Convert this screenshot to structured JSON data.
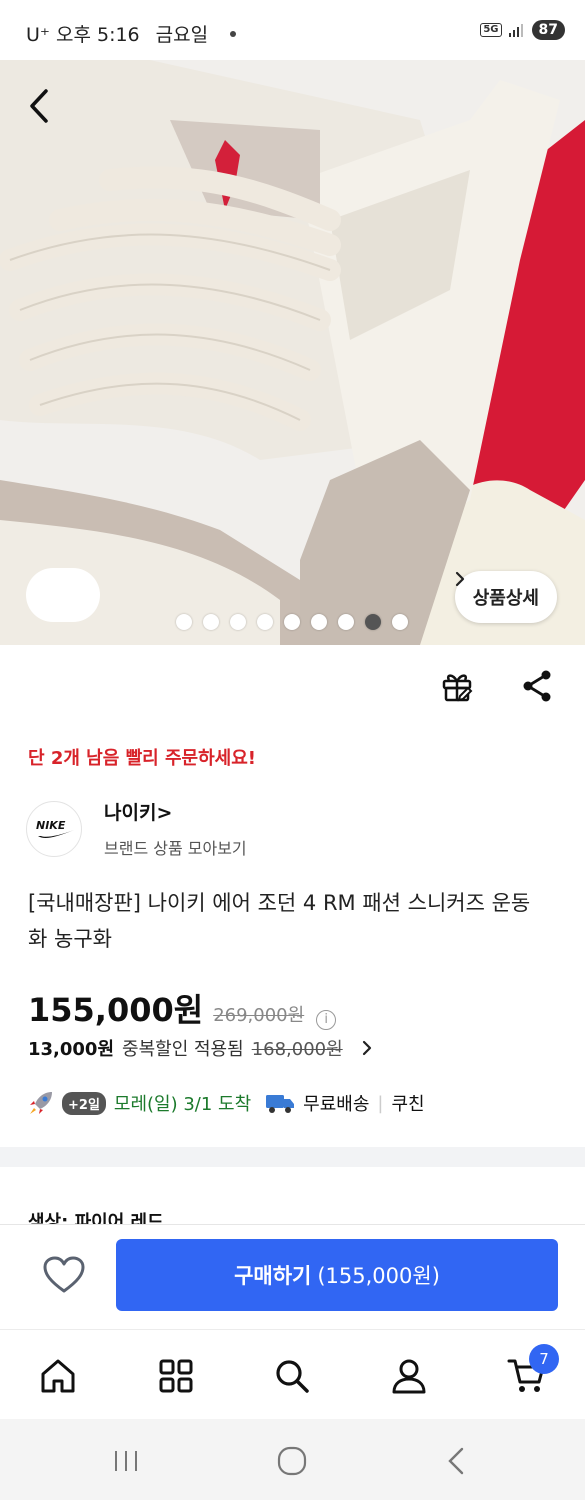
{
  "status_bar": {
    "carrier_time": "U⁺ 오후 5:16",
    "day": "금요일",
    "network": "5G",
    "battery": "87"
  },
  "hero": {
    "detail_label": "상품상세",
    "image_count": 9,
    "active_index": 7
  },
  "urgent_notice": "단 2개 남음 빨리 주문하세요!",
  "brand": {
    "logo_text": "NIKE",
    "name": "나이키>",
    "subtitle": "브랜드 상품 모아보기"
  },
  "product": {
    "title": "[국내매장판] 나이키 에어 조던 4 RM 패션 스니커즈 운동화 농구화",
    "price": "155,000원",
    "original_price": "269,000원",
    "info_symbol": "i",
    "discount_amount": "13,000원",
    "discount_text": "중복할인 적용됨",
    "discount_old_price": "168,000원"
  },
  "delivery": {
    "badge": "+2일",
    "arrival": "모레(일) 3/1  도착",
    "shipping": "무료배송",
    "extra": "쿠친"
  },
  "color_peek": "색상: 파이어 레드",
  "buy": {
    "label": "구매하기",
    "price": "(155,000원)"
  },
  "nav": {
    "cart_count": "7"
  },
  "colors": {
    "accent": "#3166f3",
    "urgent": "#d8232a",
    "delivery_green": "#1c7a2c"
  }
}
